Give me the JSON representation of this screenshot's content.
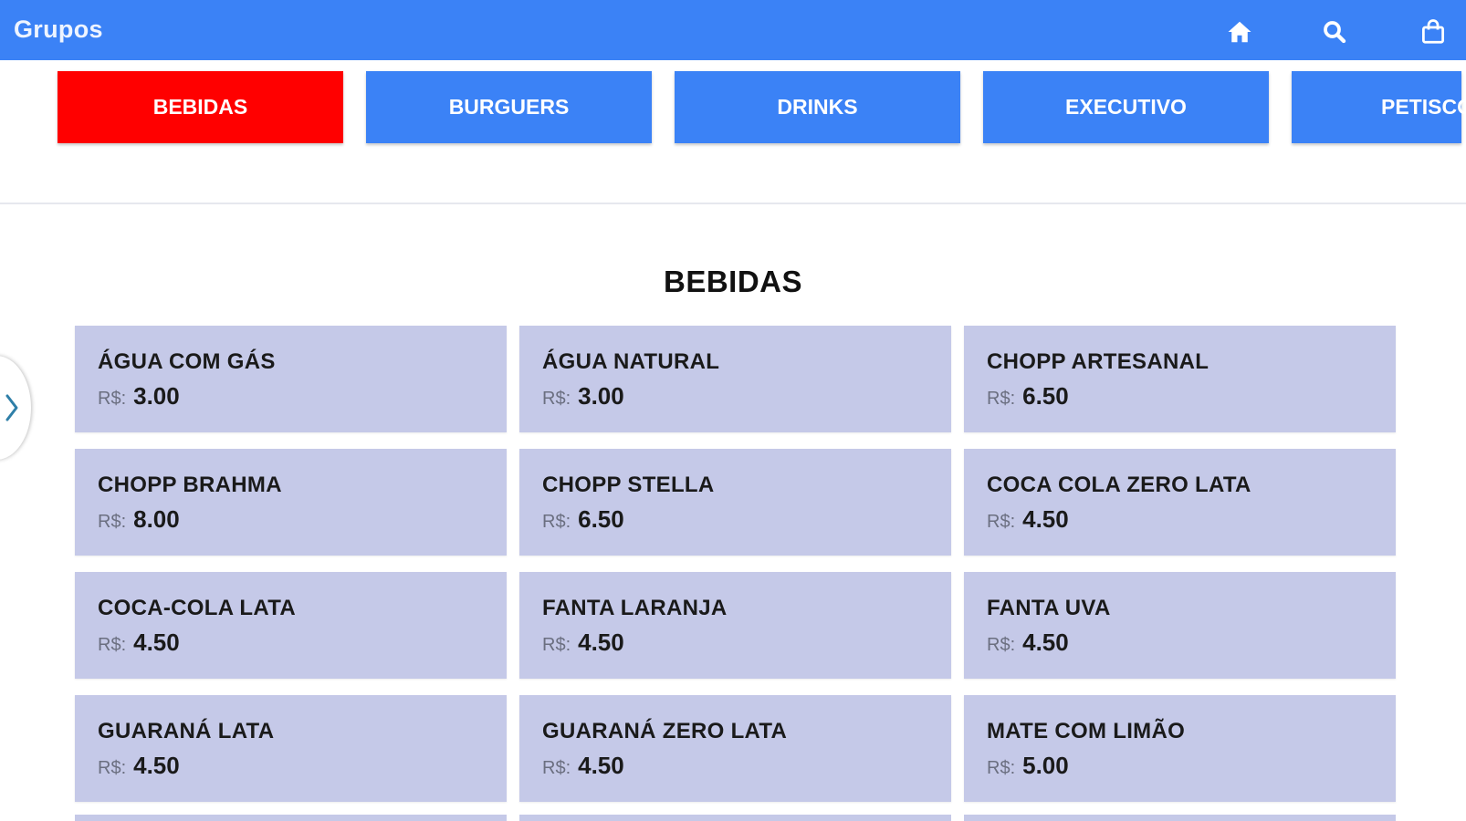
{
  "app_bar": {
    "title": "Grupos",
    "icons": [
      "home-icon",
      "search-icon",
      "shopping-bag-icon"
    ],
    "color": "#3b82f6"
  },
  "tabs": [
    {
      "label": "BEBIDAS",
      "active": true
    },
    {
      "label": "BURGUERS",
      "active": false
    },
    {
      "label": "DRINKS",
      "active": false
    },
    {
      "label": "EXECUTIVO",
      "active": false
    },
    {
      "label": "PETISCOS",
      "active": false
    }
  ],
  "section": {
    "title": "BEBIDAS"
  },
  "currency_label": "R$:",
  "products": [
    {
      "name": "ÁGUA COM GÁS",
      "price": "3.00"
    },
    {
      "name": "ÁGUA NATURAL",
      "price": "3.00"
    },
    {
      "name": "CHOPP ARTESANAL",
      "price": "6.50"
    },
    {
      "name": "CHOPP BRAHMA",
      "price": "8.00"
    },
    {
      "name": "CHOPP STELLA",
      "price": "6.50"
    },
    {
      "name": "COCA COLA ZERO LATA",
      "price": "4.50"
    },
    {
      "name": "COCA-COLA LATA",
      "price": "4.50"
    },
    {
      "name": "FANTA LARANJA",
      "price": "4.50"
    },
    {
      "name": "FANTA UVA",
      "price": "4.50"
    },
    {
      "name": "GUARANÁ LATA",
      "price": "4.50"
    },
    {
      "name": "GUARANÁ ZERO LATA",
      "price": "4.50"
    },
    {
      "name": "MATE COM LIMÃO",
      "price": "5.00"
    }
  ],
  "colors": {
    "active_tab": "#ff0000",
    "tab": "#3b82f6",
    "card_background": "#c5c9e8"
  }
}
